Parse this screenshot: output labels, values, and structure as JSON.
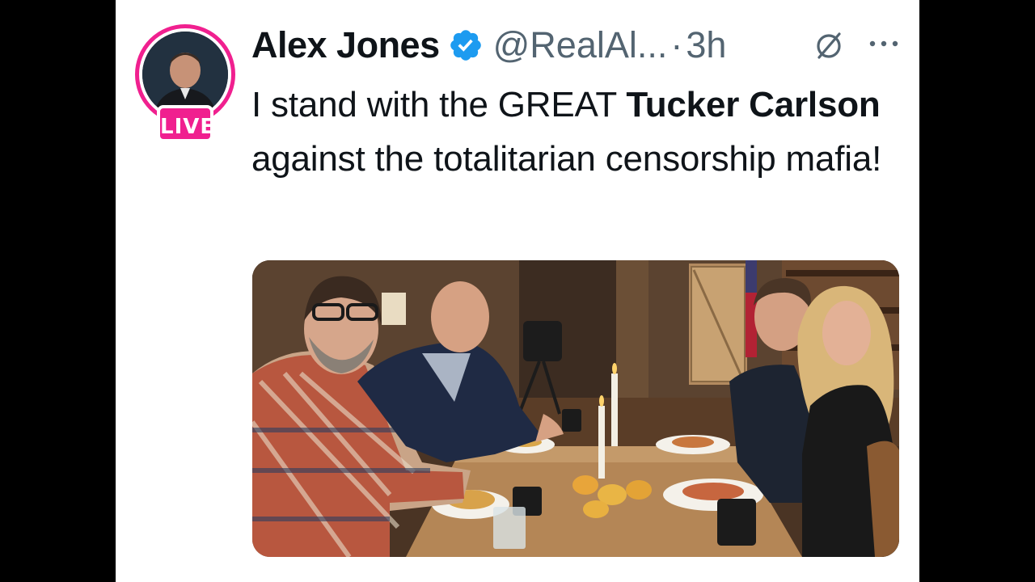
{
  "author": {
    "name": "Alex Jones",
    "handle": "@RealAl...",
    "separator": "·",
    "time": "3h",
    "live_badge": "LIVE",
    "verified_icon": "verified-badge-icon",
    "avatar_icon": "profile-avatar"
  },
  "tweet": {
    "text_1": "I stand with the GREAT ",
    "text_bold": "Tucker Carlson",
    "text_2": " against the totalitarian censorship mafia!"
  },
  "actions": {
    "grok_icon": "grok-icon",
    "more_icon": "more-options-icon"
  },
  "colors": {
    "live_pink": "#f0208f",
    "verified_blue": "#1d9bf0",
    "secondary_text": "#536471",
    "text": "#0f1419"
  }
}
